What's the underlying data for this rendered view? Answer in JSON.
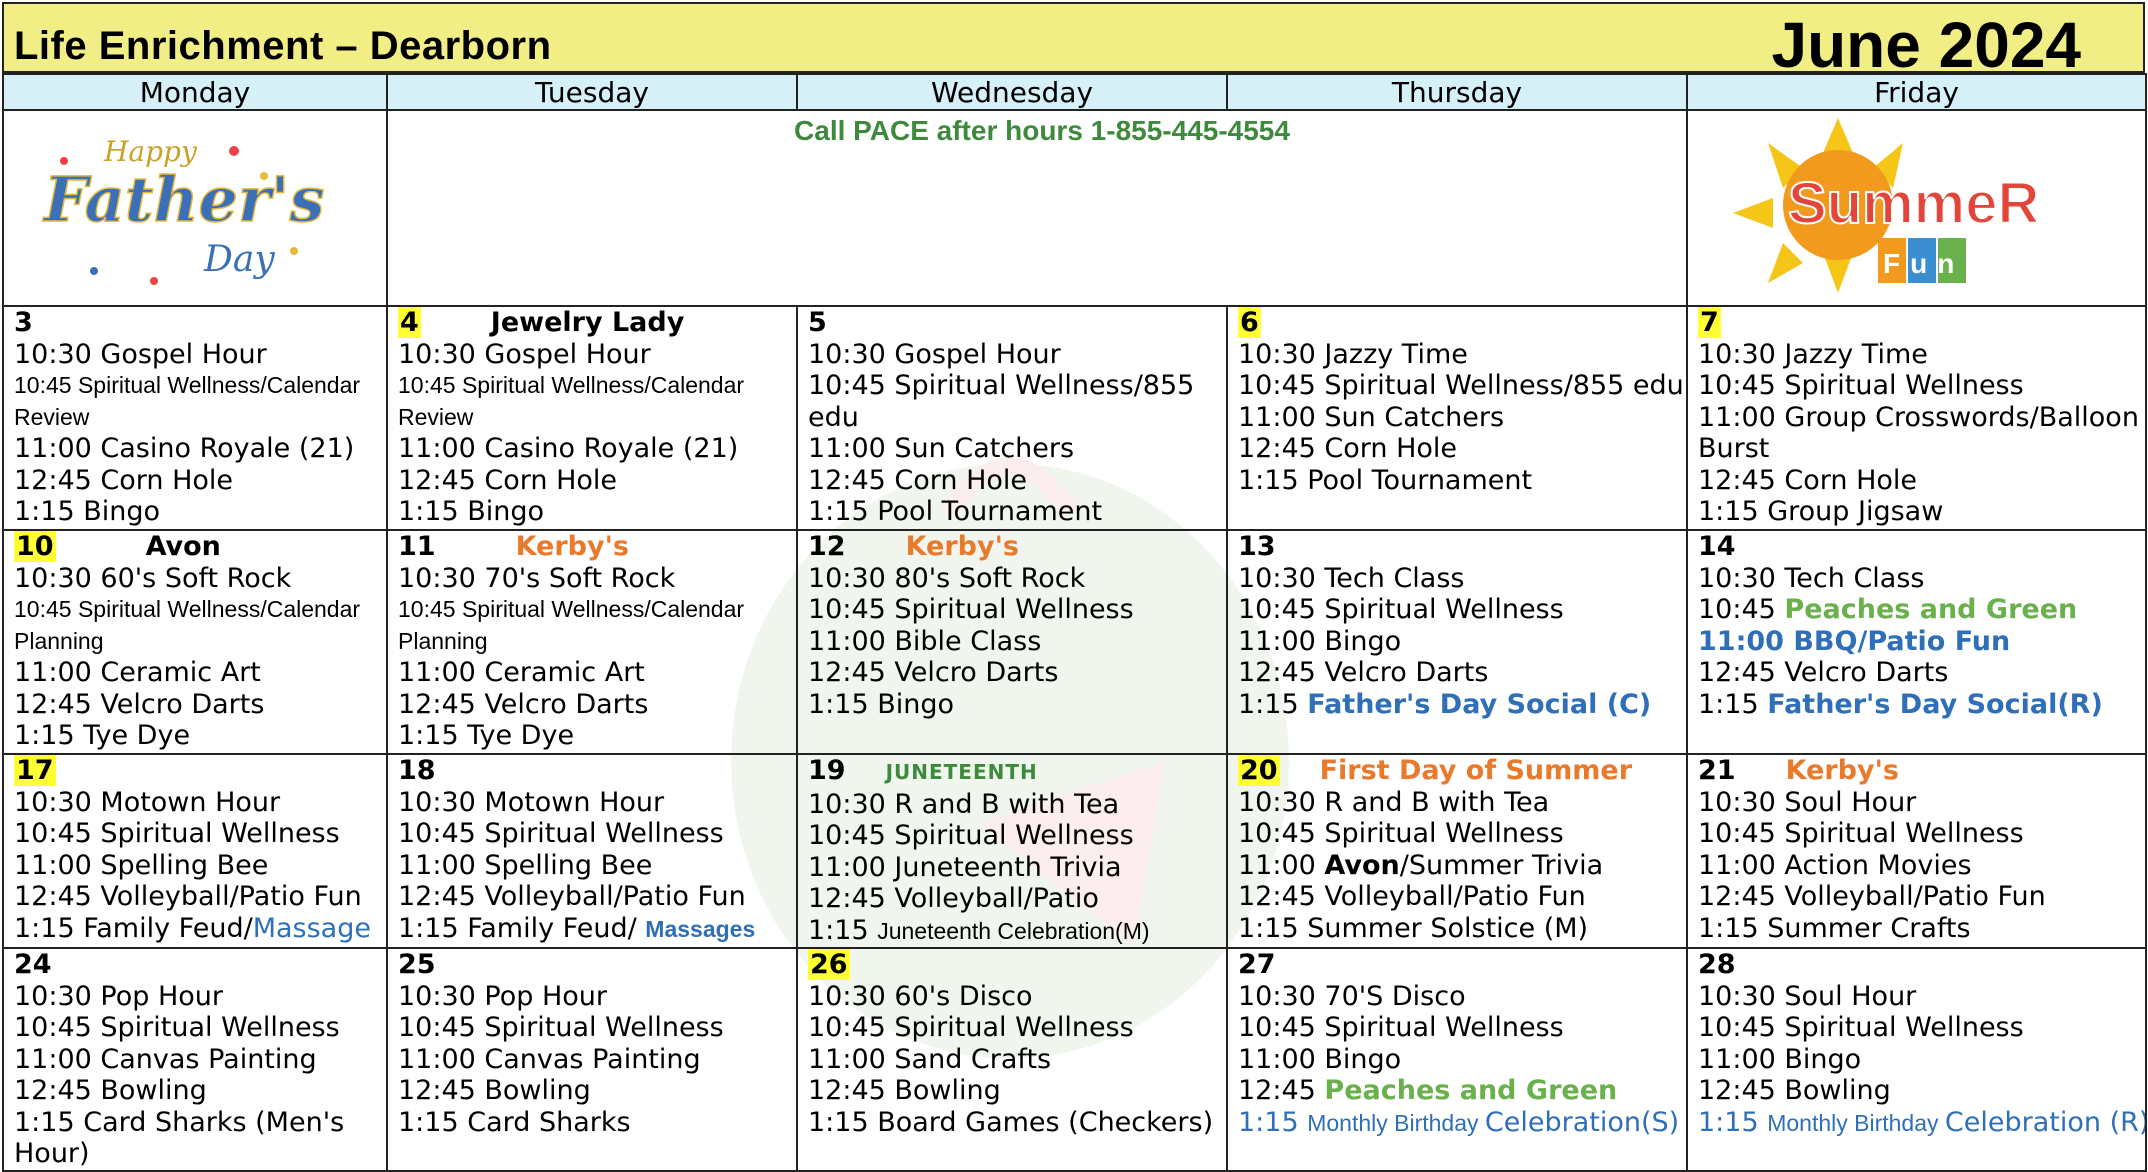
{
  "header": {
    "title": "Life Enrichment – Dearborn",
    "month": "June 2024"
  },
  "days": [
    "Monday",
    "Tuesday",
    "Wednesday",
    "Thursday",
    "Friday"
  ],
  "banner": {
    "call": "Call PACE after hours 1-855-445-4554",
    "fathers_day": {
      "happy": "Happy",
      "fathers": "Father's",
      "day": "Day"
    },
    "summer": {
      "summer": "SummeR",
      "fun": "Fun"
    }
  },
  "weeks": [
    [
      {
        "date": "3",
        "lines": [
          "10:30 Gospel Hour",
          "10:45 Spiritual Wellness/Calendar Review",
          "11:00 Casino Royale (21)",
          "12:45 Corn Hole",
          "1:15 Bingo"
        ]
      },
      {
        "date": "4",
        "event": "Jewelry Lady",
        "lines": [
          "10:30 Gospel Hour",
          "10:45 Spiritual Wellness/Calendar Review",
          "11:00 Casino Royale (21)",
          "12:45 Corn Hole",
          "1:15 Bingo"
        ]
      },
      {
        "date": "5",
        "lines": [
          "10:30 Gospel Hour",
          "10:45 Spiritual Wellness/855 edu",
          "11:00 Sun Catchers",
          "12:45 Corn Hole",
          "1:15 Pool Tournament"
        ]
      },
      {
        "date": "6",
        "lines": [
          "10:30 Jazzy Time",
          "10:45 Spiritual Wellness/855 edu",
          "11:00 Sun Catchers",
          "12:45 Corn Hole",
          "1:15 Pool Tournament"
        ]
      },
      {
        "date": "7",
        "lines": [
          "10:30 Jazzy Time",
          "10:45 Spiritual Wellness",
          "11:00 Group Crosswords/Balloon Burst",
          "12:45 Corn Hole",
          "1:15 Group Jigsaw"
        ]
      }
    ],
    [
      {
        "date": "10",
        "event": "Avon",
        "lines": [
          "10:30 60's Soft Rock",
          "10:45 Spiritual Wellness/Calendar Planning",
          "11:00 Ceramic Art",
          "12:45 Velcro Darts",
          "1:15 Tye Dye"
        ]
      },
      {
        "date": "11",
        "event": "Kerby's",
        "lines": [
          "10:30 70's Soft Rock",
          "10:45 Spiritual Wellness/Calendar Planning",
          "11:00 Ceramic Art",
          "12:45 Velcro Darts",
          "1:15 Tye Dye"
        ]
      },
      {
        "date": "12",
        "event": "Kerby's",
        "lines": [
          "10:30 80's Soft Rock",
          "10:45 Spiritual Wellness",
          "11:00 Bible Class",
          "12:45 Velcro Darts",
          "1:15 Bingo"
        ]
      },
      {
        "date": "13",
        "lines": [
          "10:30 Tech Class",
          "10:45 Spiritual Wellness",
          "11:00 Bingo",
          "12:45 Velcro Darts"
        ],
        "last_pre": "1:15 ",
        "last_hl": "Father's Day Social (C)"
      },
      {
        "date": "14",
        "lines": [
          "10:30 Tech Class"
        ],
        "l2_pre": "10:45 ",
        "l2_hl": "Peaches and Green",
        "l3": "11:00 BBQ/Patio Fun",
        "l4": "12:45 Velcro Darts",
        "last_pre": "1:15 ",
        "last_hl": "Father's Day Social(R)"
      }
    ],
    [
      {
        "date": "17",
        "lines": [
          "10:30 Motown Hour",
          "10:45 Spiritual Wellness",
          "11:00 Spelling Bee",
          "12:45 Volleyball/Patio Fun"
        ],
        "last_pre": "1:15 Family Feud/",
        "last_hl": "Massage"
      },
      {
        "date": "18",
        "lines": [
          "10:30 Motown Hour",
          "10:45 Spiritual Wellness",
          "11:00 Spelling Bee",
          "12:45 Volleyball/Patio Fun"
        ],
        "last_pre": "1:15 Family Feud/ ",
        "last_hl": "Massages"
      },
      {
        "date": "19",
        "event": "JUNETEENTH",
        "lines": [
          "10:30 R and B with Tea",
          "10:45 Spiritual Wellness",
          "11:00 Juneteenth Trivia",
          "12:45 Volleyball/Patio"
        ],
        "last_pre": "1:15 ",
        "last_sm": "Juneteenth Celebration(M)"
      },
      {
        "date": "20",
        "event": "First Day of Summer",
        "lines": [
          "10:30 R and B with Tea",
          "10:45 Spiritual Wellness"
        ],
        "l3_pre": "11:00 ",
        "l3_b": "Avon",
        "l3_post": "/Summer Trivia",
        "l4": "12:45 Volleyball/Patio Fun",
        "last": "1:15 Summer Solstice (M)"
      },
      {
        "date": "21",
        "event": "Kerby's",
        "lines": [
          "10:30 Soul Hour",
          "10:45 Spiritual Wellness",
          "11:00 Action Movies",
          "12:45 Volleyball/Patio Fun",
          "1:15 Summer Crafts"
        ]
      }
    ],
    [
      {
        "date": "24",
        "lines": [
          "10:30 Pop Hour",
          "10:45 Spiritual Wellness",
          "11:00 Canvas Painting",
          "12:45 Bowling",
          "1:15 Card Sharks (Men's Hour)"
        ]
      },
      {
        "date": "25",
        "lines": [
          "10:30 Pop Hour",
          "10:45 Spiritual Wellness",
          "11:00 Canvas Painting",
          "12:45 Bowling",
          "1:15 Card Sharks"
        ]
      },
      {
        "date": "26",
        "lines": [
          "10:30 60's Disco",
          "10:45 Spiritual Wellness",
          "11:00 Sand Crafts",
          "12:45 Bowling",
          "1:15 Board Games (Checkers)"
        ]
      },
      {
        "date": "27",
        "lines": [
          "10:30 70'S Disco",
          "10:45 Spiritual Wellness",
          "11:00 Bingo"
        ],
        "l4_pre": "12:45 ",
        "l4_hl": "Peaches and Green",
        "last_a": "1:15 ",
        "last_sm": "Monthly Birthday ",
        "last_c": "Celebration(S)"
      },
      {
        "date": "28",
        "lines": [
          "10:30 Soul Hour",
          "10:45 Spiritual Wellness",
          "11:00 Bingo",
          "12:45 Bowling"
        ],
        "last_a": "1:15 ",
        "last_sm": "Monthly Birthday ",
        "last_c": "Celebration (R)"
      }
    ]
  ],
  "colors": {
    "header_bg": "#f2ee86",
    "day_bg": "#d6f0f7",
    "highlight": "#ffff33",
    "orange": "#e97a2c",
    "blue": "#2f6fb8",
    "green": "#6ab04c",
    "call_green": "#3d8a3d"
  }
}
